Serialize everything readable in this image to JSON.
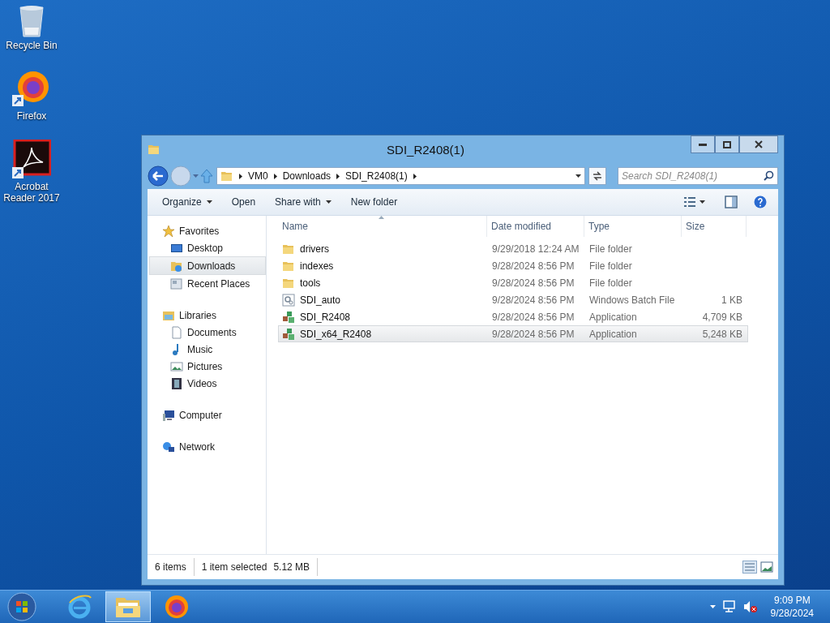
{
  "desktop_icons": [
    {
      "kind": "recycle",
      "label": "Recycle Bin"
    },
    {
      "kind": "firefox",
      "label": "Firefox"
    },
    {
      "kind": "acrobat",
      "label": "Acrobat Reader 2017"
    }
  ],
  "window": {
    "title": "SDI_R2408(1)",
    "breadcrumb": [
      "VM0",
      "Downloads",
      "SDI_R2408(1)"
    ],
    "search": {
      "placeholder": "Search SDI_R2408(1)"
    },
    "toolbar": [
      {
        "label": "Organize",
        "menu": true
      },
      {
        "label": "Open",
        "menu": false
      },
      {
        "label": "Share with",
        "menu": true
      },
      {
        "label": "New folder",
        "menu": false
      }
    ],
    "nav": [
      {
        "kind": "star",
        "label": "Favorites",
        "selected": false,
        "children": [
          {
            "kind": "desktop",
            "label": "Desktop",
            "selected": false
          },
          {
            "kind": "downloads",
            "label": "Downloads",
            "selected": true
          },
          {
            "kind": "recent",
            "label": "Recent Places",
            "selected": false
          }
        ]
      },
      {
        "kind": "libraries",
        "label": "Libraries",
        "selected": false,
        "children": [
          {
            "kind": "document",
            "label": "Documents",
            "selected": false
          },
          {
            "kind": "music",
            "label": "Music",
            "selected": false
          },
          {
            "kind": "pictures",
            "label": "Pictures",
            "selected": false
          },
          {
            "kind": "videos",
            "label": "Videos",
            "selected": false
          }
        ]
      },
      {
        "kind": "computer",
        "label": "Computer",
        "selected": false
      },
      {
        "kind": "network",
        "label": "Network",
        "selected": false
      }
    ],
    "columns": [
      "Name",
      "Date modified",
      "Type",
      "Size"
    ],
    "rows": [
      {
        "kind": "folder",
        "name": "drivers",
        "date": "9/29/2018 12:24 AM",
        "type": "File folder",
        "selected": false
      },
      {
        "kind": "folder",
        "name": "indexes",
        "date": "9/28/2024 8:56 PM",
        "type": "File folder",
        "selected": false
      },
      {
        "kind": "folder",
        "name": "tools",
        "date": "9/28/2024 8:56 PM",
        "type": "File folder",
        "selected": false
      },
      {
        "kind": "batch",
        "name": "SDI_auto",
        "date": "9/28/2024 8:56 PM",
        "type": "Windows Batch File",
        "size": "1 KB",
        "selected": false
      },
      {
        "kind": "app",
        "name": "SDI_R2408",
        "date": "9/28/2024 8:56 PM",
        "type": "Application",
        "size": "4,709 KB",
        "selected": false
      },
      {
        "kind": "app",
        "name": "SDI_x64_R2408",
        "date": "9/28/2024 8:56 PM",
        "type": "Application",
        "size": "5,248 KB",
        "selected": true
      }
    ],
    "status": {
      "count": "6 items",
      "selection": "1 item selected",
      "size": "5.12 MB"
    }
  },
  "taskbar": {
    "apps": [
      {
        "kind": "ie",
        "active": false
      },
      {
        "kind": "explorer",
        "active": true
      },
      {
        "kind": "firefox",
        "active": false
      }
    ],
    "clock": {
      "time": "9:09 PM",
      "date": "9/28/2024"
    }
  }
}
